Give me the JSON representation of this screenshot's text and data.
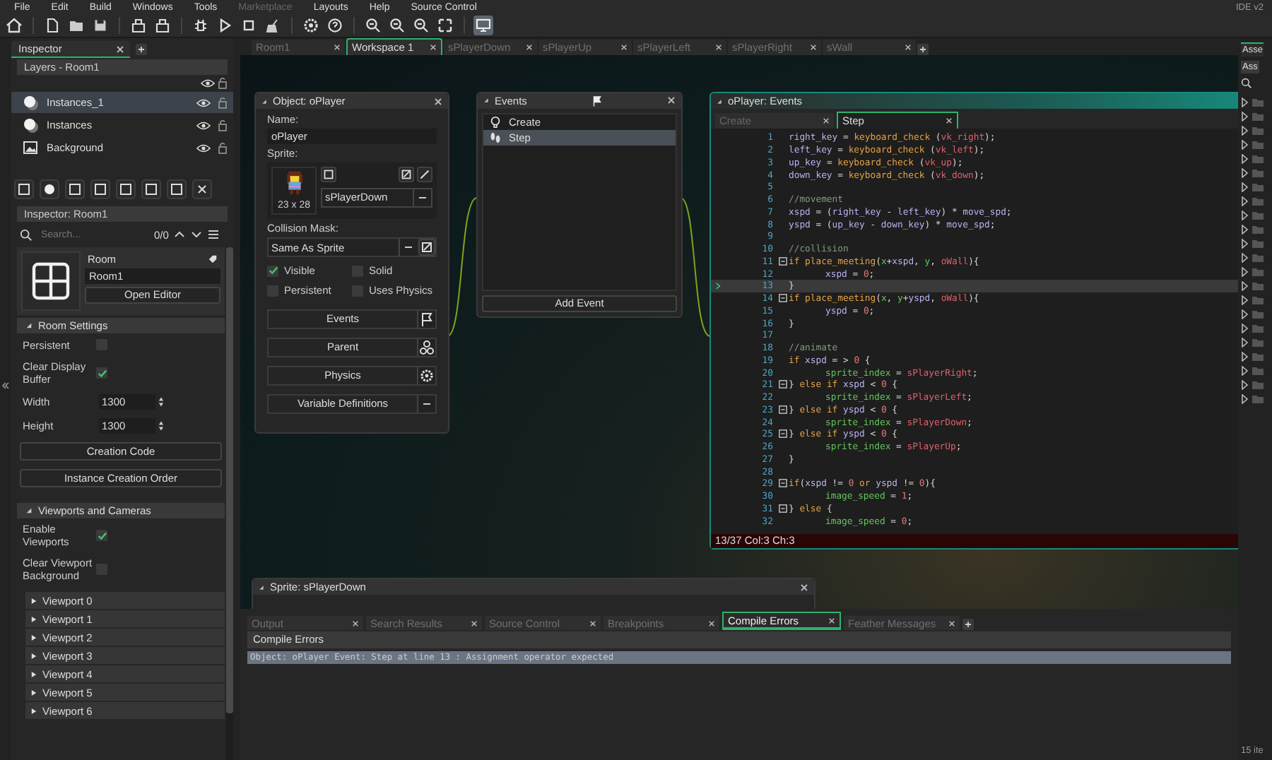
{
  "menu": [
    {
      "label": "File",
      "disabled": false
    },
    {
      "label": "Edit",
      "disabled": false
    },
    {
      "label": "Build",
      "disabled": false
    },
    {
      "label": "Windows",
      "disabled": false
    },
    {
      "label": "Tools",
      "disabled": false
    },
    {
      "label": "Marketplace",
      "disabled": true
    },
    {
      "label": "Layouts",
      "disabled": false
    },
    {
      "label": "Help",
      "disabled": false
    },
    {
      "label": "Source Control",
      "disabled": false
    }
  ],
  "version_label": "IDE v2",
  "inspector_tab": "Inspector",
  "layers": {
    "dropdown": "Layers - Room1",
    "items": [
      {
        "name": "Instances_1",
        "kind": "instances",
        "selected": true
      },
      {
        "name": "Instances",
        "kind": "instances",
        "selected": false
      },
      {
        "name": "Background",
        "kind": "background",
        "selected": false
      }
    ]
  },
  "room_inspector": {
    "dropdown": "Inspector: Room1",
    "search_placeholder": "Search...",
    "match_count": "0/0",
    "type_label": "Room",
    "name": "Room1",
    "open_editor": "Open Editor"
  },
  "room_settings": {
    "title": "Room Settings",
    "options": [
      {
        "label": "Persistent",
        "checked": false
      },
      {
        "label": "Clear Display Buffer",
        "checked": true
      }
    ],
    "fields": [
      {
        "label": "Width",
        "value": "1300"
      },
      {
        "label": "Height",
        "value": "1300"
      }
    ],
    "buttons": [
      "Creation Code",
      "Instance Creation Order"
    ]
  },
  "viewports": {
    "title": "Viewports and Cameras",
    "options": [
      {
        "label": "Enable Viewports",
        "checked": true
      },
      {
        "label": "Clear Viewport Background",
        "checked": false
      }
    ],
    "items": [
      "Viewport 0",
      "Viewport 1",
      "Viewport 2",
      "Viewport 3",
      "Viewport 4",
      "Viewport 5",
      "Viewport 6"
    ]
  },
  "workspace_tabs": [
    {
      "label": "Room1",
      "selected": false
    },
    {
      "label": "Workspace 1",
      "selected": true
    },
    {
      "label": "sPlayerDown",
      "selected": false
    },
    {
      "label": "sPlayerUp",
      "selected": false
    },
    {
      "label": "sPlayerLeft",
      "selected": false
    },
    {
      "label": "sPlayerRight",
      "selected": false
    },
    {
      "label": "sWall",
      "selected": false
    }
  ],
  "object_window": {
    "title": "Object: oPlayer",
    "name_label": "Name:",
    "name": "oPlayer",
    "sprite_label": "Sprite:",
    "sprite_size": "23 x 28",
    "sprite": "sPlayerDown",
    "mask_label": "Collision Mask:",
    "mask": "Same As Sprite",
    "options": [
      {
        "label": "Visible",
        "checked": true
      },
      {
        "label": "Solid",
        "checked": false
      },
      {
        "label": "Persistent",
        "checked": false
      },
      {
        "label": "Uses Physics",
        "checked": false
      }
    ],
    "buttons": [
      {
        "label": "Events",
        "kind": "flag"
      },
      {
        "label": "Parent",
        "kind": "parent"
      },
      {
        "label": "Physics",
        "kind": "gear"
      },
      {
        "label": "Variable Definitions",
        "kind": "more"
      }
    ]
  },
  "events_window": {
    "title": "Events",
    "events": [
      {
        "name": "Create",
        "kind": "create",
        "selected": false
      },
      {
        "name": "Step",
        "kind": "step",
        "selected": true
      }
    ],
    "add_button": "Add Event"
  },
  "code_window": {
    "title": "oPlayer: Events",
    "tabs": [
      {
        "label": "Create",
        "selected": false
      },
      {
        "label": "Step",
        "selected": true
      }
    ],
    "lines": [
      {
        "n": "1",
        "fold": false,
        "current": false,
        "indented": false,
        "tokens": [
          {
            "text": "right_key",
            "kind": "var"
          },
          {
            "text": " = ",
            "kind": "op"
          },
          {
            "text": "keyboard_check",
            "kind": "func"
          },
          {
            "text": " (",
            "kind": "op"
          },
          {
            "text": "vk_right",
            "kind": "res"
          },
          {
            "text": ");",
            "kind": "op"
          }
        ]
      },
      {
        "n": "2",
        "fold": false,
        "current": false,
        "indented": false,
        "tokens": [
          {
            "text": "left_key",
            "kind": "var"
          },
          {
            "text": " = ",
            "kind": "op"
          },
          {
            "text": "keyboard_check",
            "kind": "func"
          },
          {
            "text": " (",
            "kind": "op"
          },
          {
            "text": "vk_left",
            "kind": "res"
          },
          {
            "text": ");",
            "kind": "op"
          }
        ]
      },
      {
        "n": "3",
        "fold": false,
        "current": false,
        "indented": false,
        "tokens": [
          {
            "text": "up_key",
            "kind": "var"
          },
          {
            "text": " = ",
            "kind": "op"
          },
          {
            "text": "keyboard_check",
            "kind": "func"
          },
          {
            "text": " (",
            "kind": "op"
          },
          {
            "text": "vk_up",
            "kind": "res"
          },
          {
            "text": ");",
            "kind": "op"
          }
        ]
      },
      {
        "n": "4",
        "fold": false,
        "current": false,
        "indented": false,
        "tokens": [
          {
            "text": "down_key",
            "kind": "var"
          },
          {
            "text": " = ",
            "kind": "op"
          },
          {
            "text": "keyboard_check",
            "kind": "func"
          },
          {
            "text": " (",
            "kind": "op"
          },
          {
            "text": "vk_down",
            "kind": "res"
          },
          {
            "text": ");",
            "kind": "op"
          }
        ]
      },
      {
        "n": "5",
        "fold": false,
        "current": false
      },
      {
        "n": "6",
        "fold": false,
        "current": false,
        "indented": false,
        "tokens": [
          {
            "text": "//movement",
            "kind": "comment"
          }
        ]
      },
      {
        "n": "7",
        "fold": false,
        "current": false,
        "indented": false,
        "tokens": [
          {
            "text": "xspd",
            "kind": "var"
          },
          {
            "text": " = (",
            "kind": "op"
          },
          {
            "text": "right_key",
            "kind": "var"
          },
          {
            "text": " - ",
            "kind": "op"
          },
          {
            "text": "left_key",
            "kind": "var"
          },
          {
            "text": ") * ",
            "kind": "op"
          },
          {
            "text": "move_spd",
            "kind": "var"
          },
          {
            "text": ";",
            "kind": "op"
          }
        ]
      },
      {
        "n": "8",
        "fold": false,
        "current": false,
        "indented": false,
        "tokens": [
          {
            "text": "yspd",
            "kind": "var"
          },
          {
            "text": " = (",
            "kind": "op"
          },
          {
            "text": "up_key",
            "kind": "var"
          },
          {
            "text": " - ",
            "kind": "op"
          },
          {
            "text": "down_key",
            "kind": "var"
          },
          {
            "text": ") * ",
            "kind": "op"
          },
          {
            "text": "move_spd",
            "kind": "var"
          },
          {
            "text": ";",
            "kind": "op"
          }
        ]
      },
      {
        "n": "9",
        "fold": false,
        "current": false
      },
      {
        "n": "10",
        "fold": false,
        "current": false,
        "indented": false,
        "tokens": [
          {
            "text": "//collision",
            "kind": "comment"
          }
        ]
      },
      {
        "n": "11",
        "fold": true,
        "current": false,
        "indented": false,
        "tokens": [
          {
            "text": "if",
            "kind": "kw"
          },
          {
            "text": " place_meeting",
            "kind": "func"
          },
          {
            "text": "(",
            "kind": "op"
          },
          {
            "text": "x",
            "kind": "builtin"
          },
          {
            "text": "+",
            "kind": "op"
          },
          {
            "text": "xspd",
            "kind": "var"
          },
          {
            "text": ", ",
            "kind": "op"
          },
          {
            "text": "y",
            "kind": "builtin"
          },
          {
            "text": ", ",
            "kind": "op"
          },
          {
            "text": "oWall",
            "kind": "res"
          },
          {
            "text": "){",
            "kind": "op"
          }
        ]
      },
      {
        "n": "12",
        "fold": false,
        "current": false,
        "indented": true,
        "tokens": [
          {
            "text": "xspd",
            "kind": "var"
          },
          {
            "text": " = ",
            "kind": "op"
          },
          {
            "text": "0",
            "kind": "num"
          },
          {
            "text": ";",
            "kind": "op"
          }
        ]
      },
      {
        "n": "13",
        "fold": false,
        "current": true,
        "indented": false,
        "tokens": [
          {
            "text": "}",
            "kind": "op"
          }
        ]
      },
      {
        "n": "14",
        "fold": true,
        "current": false,
        "indented": false,
        "tokens": [
          {
            "text": "if",
            "kind": "kw"
          },
          {
            "text": " place_meeting",
            "kind": "func"
          },
          {
            "text": "(",
            "kind": "op"
          },
          {
            "text": "x",
            "kind": "builtin"
          },
          {
            "text": ", ",
            "kind": "op"
          },
          {
            "text": "y",
            "kind": "builtin"
          },
          {
            "text": "+",
            "kind": "op"
          },
          {
            "text": "yspd",
            "kind": "var"
          },
          {
            "text": ", ",
            "kind": "op"
          },
          {
            "text": "oWall",
            "kind": "res"
          },
          {
            "text": "){",
            "kind": "op"
          }
        ]
      },
      {
        "n": "15",
        "fold": false,
        "current": false,
        "indented": true,
        "tokens": [
          {
            "text": "yspd",
            "kind": "var"
          },
          {
            "text": " = ",
            "kind": "op"
          },
          {
            "text": "0",
            "kind": "num"
          },
          {
            "text": ";",
            "kind": "op"
          }
        ]
      },
      {
        "n": "16",
        "fold": false,
        "current": false,
        "indented": false,
        "tokens": [
          {
            "text": "}",
            "kind": "op"
          }
        ]
      },
      {
        "n": "17",
        "fold": false,
        "current": false
      },
      {
        "n": "18",
        "fold": false,
        "current": false,
        "indented": false,
        "tokens": [
          {
            "text": "//animate",
            "kind": "comment"
          }
        ]
      },
      {
        "n": "19",
        "fold": false,
        "current": false,
        "indented": false,
        "tokens": [
          {
            "text": "if",
            "kind": "kw"
          },
          {
            "text": " xspd",
            "kind": "var"
          },
          {
            "text": " = > ",
            "kind": "op"
          },
          {
            "text": "0",
            "kind": "num"
          },
          {
            "text": " {",
            "kind": "op"
          }
        ]
      },
      {
        "n": "20",
        "fold": false,
        "current": false,
        "indented": true,
        "tokens": [
          {
            "text": "sprite_index",
            "kind": "builtin"
          },
          {
            "text": " = ",
            "kind": "op"
          },
          {
            "text": "sPlayerRight",
            "kind": "res"
          },
          {
            "text": ";",
            "kind": "op"
          }
        ]
      },
      {
        "n": "21",
        "fold": true,
        "current": false,
        "indented": false,
        "tokens": [
          {
            "text": "} ",
            "kind": "op"
          },
          {
            "text": "else if",
            "kind": "kw"
          },
          {
            "text": " xspd",
            "kind": "var"
          },
          {
            "text": " < ",
            "kind": "op"
          },
          {
            "text": "0",
            "kind": "num"
          },
          {
            "text": " {",
            "kind": "op"
          }
        ]
      },
      {
        "n": "22",
        "fold": false,
        "current": false,
        "indented": true,
        "tokens": [
          {
            "text": "sprite_index",
            "kind": "builtin"
          },
          {
            "text": " = ",
            "kind": "op"
          },
          {
            "text": "sPlayerLeft",
            "kind": "res"
          },
          {
            "text": ";",
            "kind": "op"
          }
        ]
      },
      {
        "n": "23",
        "fold": true,
        "current": false,
        "indented": false,
        "tokens": [
          {
            "text": "} ",
            "kind": "op"
          },
          {
            "text": "else if",
            "kind": "kw"
          },
          {
            "text": " yspd",
            "kind": "var"
          },
          {
            "text": " < ",
            "kind": "op"
          },
          {
            "text": "0",
            "kind": "num"
          },
          {
            "text": " {",
            "kind": "op"
          }
        ]
      },
      {
        "n": "24",
        "fold": false,
        "current": false,
        "indented": true,
        "tokens": [
          {
            "text": "sprite_index",
            "kind": "builtin"
          },
          {
            "text": " = ",
            "kind": "op"
          },
          {
            "text": "sPlayerDown",
            "kind": "res"
          },
          {
            "text": ";",
            "kind": "op"
          }
        ]
      },
      {
        "n": "25",
        "fold": true,
        "current": false,
        "indented": false,
        "tokens": [
          {
            "text": "} ",
            "kind": "op"
          },
          {
            "text": "else if",
            "kind": "kw"
          },
          {
            "text": " yspd",
            "kind": "var"
          },
          {
            "text": " < ",
            "kind": "op"
          },
          {
            "text": "0",
            "kind": "num"
          },
          {
            "text": " {",
            "kind": "op"
          }
        ]
      },
      {
        "n": "26",
        "fold": false,
        "current": false,
        "indented": true,
        "tokens": [
          {
            "text": "sprite_index",
            "kind": "builtin"
          },
          {
            "text": " = ",
            "kind": "op"
          },
          {
            "text": "sPlayerUp",
            "kind": "res"
          },
          {
            "text": ";",
            "kind": "op"
          }
        ]
      },
      {
        "n": "27",
        "fold": false,
        "current": false,
        "indented": false,
        "tokens": [
          {
            "text": "}",
            "kind": "op"
          }
        ]
      },
      {
        "n": "28",
        "fold": false,
        "current": false
      },
      {
        "n": "29",
        "fold": true,
        "current": false,
        "indented": false,
        "tokens": [
          {
            "text": "if",
            "kind": "kw"
          },
          {
            "text": "(",
            "kind": "op"
          },
          {
            "text": "xspd",
            "kind": "var"
          },
          {
            "text": " != ",
            "kind": "op"
          },
          {
            "text": "0",
            "kind": "num"
          },
          {
            "text": " or",
            "kind": "kw"
          },
          {
            "text": " yspd",
            "kind": "var"
          },
          {
            "text": " != ",
            "kind": "op"
          },
          {
            "text": "0",
            "kind": "num"
          },
          {
            "text": "){",
            "kind": "op"
          }
        ]
      },
      {
        "n": "30",
        "fold": false,
        "current": false,
        "indented": true,
        "tokens": [
          {
            "text": "image_speed",
            "kind": "builtin"
          },
          {
            "text": " = ",
            "kind": "op"
          },
          {
            "text": "1",
            "kind": "num"
          },
          {
            "text": ";",
            "kind": "op"
          }
        ]
      },
      {
        "n": "31",
        "fold": true,
        "current": false,
        "indented": false,
        "tokens": [
          {
            "text": "} ",
            "kind": "op"
          },
          {
            "text": "else",
            "kind": "kw"
          },
          {
            "text": " {",
            "kind": "op"
          }
        ]
      },
      {
        "n": "32",
        "fold": false,
        "current": false,
        "indented": true,
        "tokens": [
          {
            "text": "image_speed",
            "kind": "builtin"
          },
          {
            "text": " = ",
            "kind": "op"
          },
          {
            "text": "0",
            "kind": "num"
          },
          {
            "text": ";",
            "kind": "op"
          }
        ]
      }
    ],
    "status": "13/37 Col:3 Ch:3"
  },
  "sprite_window": {
    "title": "Sprite: sPlayerDown"
  },
  "output_panel": {
    "tabs": [
      {
        "label": "Output",
        "selected": false
      },
      {
        "label": "Search Results",
        "selected": false
      },
      {
        "label": "Source Control",
        "selected": false
      },
      {
        "label": "Breakpoints",
        "selected": false
      },
      {
        "label": "Compile Errors",
        "selected": true
      },
      {
        "label": "Feather Messages",
        "selected": false
      }
    ],
    "header": "Compile Errors",
    "messages": [
      {
        "text": "Object: oPlayer Event: Step at line 13 : Assignment operator expected",
        "selected": true
      }
    ]
  },
  "asset_browser": {
    "tab": "Asse",
    "dropdown": "Ass",
    "footer": "15 ite"
  }
}
